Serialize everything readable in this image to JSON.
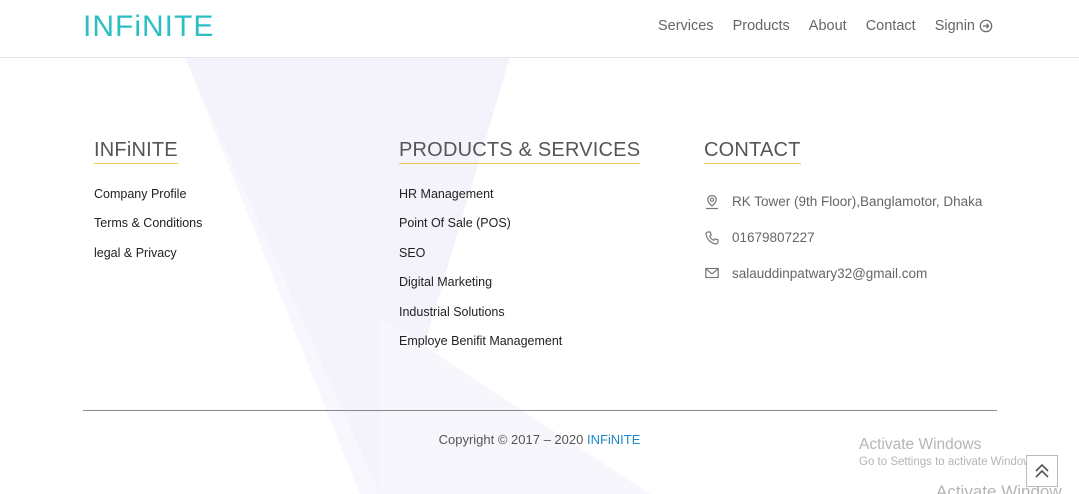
{
  "header": {
    "logo_text": "INFiNITE",
    "nav": {
      "services": "Services",
      "products": "Products",
      "about": "About",
      "contact": "Contact",
      "signin": "Signin"
    }
  },
  "footer": {
    "company": {
      "title": "INFiNITE",
      "links": [
        "Company Profile",
        "Terms & Conditions",
        "legal & Privacy"
      ]
    },
    "products": {
      "title": "PRODUCTS & SERVICES",
      "links": [
        "HR Management",
        "Point Of Sale (POS)",
        "SEO",
        "Digital Marketing",
        "Industrial Solutions",
        "Employe Benifit Management"
      ]
    },
    "contact": {
      "title": "CONTACT",
      "address": "RK Tower (9th Floor),Banglamotor, Dhaka",
      "phone": "01679807227",
      "email": "salauddinpatwary32@gmail.com"
    },
    "copyright_prefix": "Copyright © 2017 – 2020 ",
    "copyright_brand": "INFiNITE"
  },
  "watermark": {
    "title": "Activate Windows",
    "subtitle": "Go to Settings to activate Windows.",
    "ghost": "Activate Window"
  },
  "colors": {
    "brand_teal": "#2bbfc4",
    "title_underline": "#f1c84b",
    "link_blue": "#1e88c8"
  },
  "icons": {
    "address": "location-pin-icon",
    "phone": "phone-icon",
    "email": "envelope-icon",
    "signin": "arrow-circle-right-icon",
    "scroll_top": "double-chevron-up-icon"
  }
}
